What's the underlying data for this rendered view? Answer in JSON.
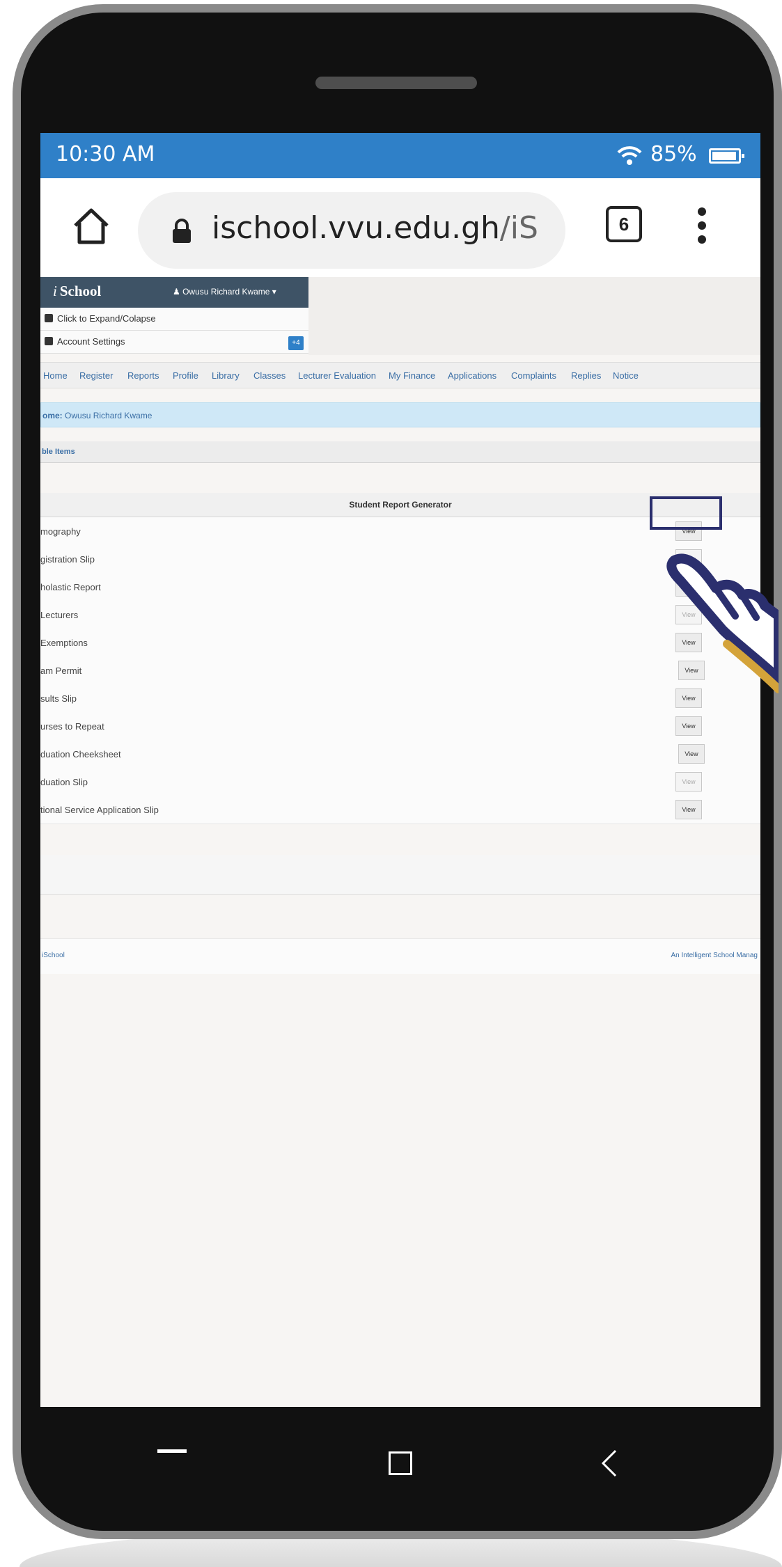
{
  "status_bar": {
    "time": "10:30 AM",
    "battery": "85%"
  },
  "browser": {
    "url_host": "ischool.vvu.edu.gh",
    "url_path": "/iStude",
    "tab_count": "6",
    "icons": {
      "home": "home-icon",
      "lock": "lock-icon",
      "menu": "kebab-menu-icon"
    }
  },
  "app": {
    "brand_prefix": "i",
    "brand_name": "School",
    "user_name": "Owusu Richard Kwame ▾",
    "side_items": [
      {
        "label": "Click to Expand/Colapse"
      },
      {
        "label": "Account Settings",
        "badge": "+4"
      }
    ],
    "nav": [
      "Home",
      "Register",
      "Reports",
      "Profile",
      "Library",
      "Classes",
      "Lecturer Evaluation",
      "My Finance",
      "Applications",
      "Complaints",
      "Replies",
      "Notice"
    ],
    "welcome_prefix": "ome:",
    "welcome_name": "Owusu Richard Kwame",
    "available_label": "ble Items"
  },
  "report": {
    "title": "Student Report Generator",
    "view_label": "View",
    "rows": [
      {
        "label": "mography"
      },
      {
        "label": "gistration Slip"
      },
      {
        "label": "holastic Report"
      },
      {
        "label": "Lecturers"
      },
      {
        "label": "Exemptions"
      },
      {
        "label": "am Permit"
      },
      {
        "label": "sults Slip"
      },
      {
        "label": "urses to Repeat"
      },
      {
        "label": "duation Cheeksheet"
      },
      {
        "label": "duation Slip"
      },
      {
        "label": "tional Service Application Slip"
      }
    ]
  },
  "footer": {
    "left": "iSchool",
    "right": "An Intelligent School Manag"
  },
  "colors": {
    "status_bar": "#2f80c8",
    "header": "#3e5366",
    "highlight": "#2b2f6e",
    "pointer_accent": "#d4a33a"
  }
}
